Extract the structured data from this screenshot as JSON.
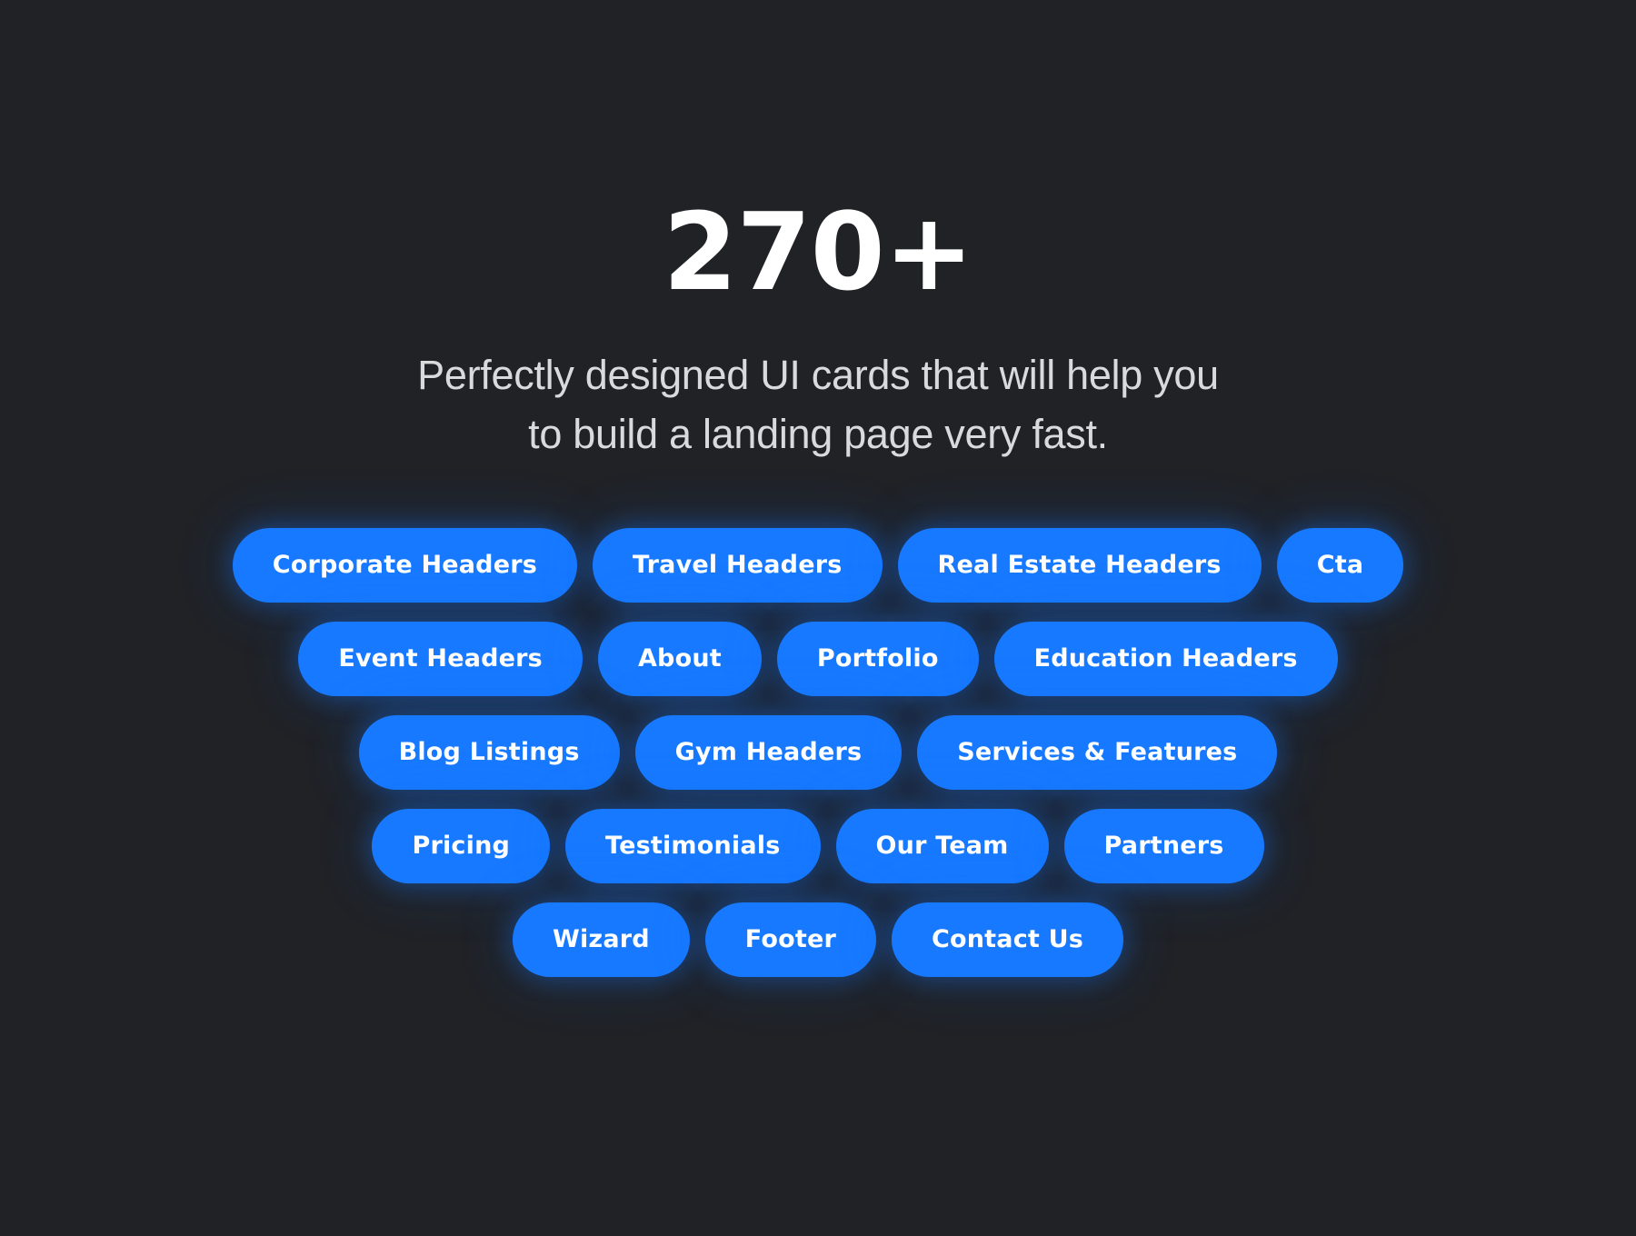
{
  "theme": {
    "background_color": "#202226",
    "pill_color": "#1779FF",
    "pill_text_color": "#FFFFFF",
    "heading_color": "#FFFFFF",
    "subtitle_color": "#D9DADC"
  },
  "hero": {
    "count": "270+",
    "subtitle_line_1": "Perfectly designed UI cards that will help you",
    "subtitle_line_2": "to build a landing page very fast."
  },
  "tag_cloud": {
    "rows": [
      {
        "tags": [
          {
            "label": "Corporate Headers"
          },
          {
            "label": "Travel Headers"
          },
          {
            "label": "Real Estate Headers"
          },
          {
            "label": "Cta"
          }
        ]
      },
      {
        "tags": [
          {
            "label": "Event Headers"
          },
          {
            "label": "About"
          },
          {
            "label": "Portfolio"
          },
          {
            "label": "Education Headers"
          }
        ]
      },
      {
        "tags": [
          {
            "label": "Blog Listings"
          },
          {
            "label": "Gym Headers"
          },
          {
            "label": "Services & Features"
          }
        ]
      },
      {
        "tags": [
          {
            "label": "Pricing"
          },
          {
            "label": "Testimonials"
          },
          {
            "label": "Our Team"
          },
          {
            "label": "Partners"
          }
        ]
      },
      {
        "tags": [
          {
            "label": "Wizard"
          },
          {
            "label": "Footer"
          },
          {
            "label": "Contact Us"
          }
        ]
      }
    ]
  }
}
